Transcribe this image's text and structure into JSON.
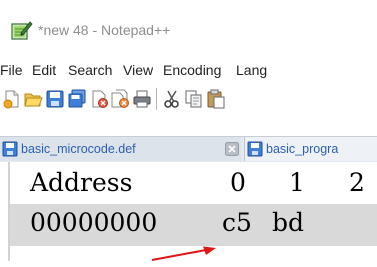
{
  "window": {
    "title": "*new 48 - Notepad++",
    "app_icon": "notepad-document-icon"
  },
  "menu": [
    "File",
    "Edit",
    "Search",
    "View",
    "Encoding",
    "Lang"
  ],
  "toolbar": {
    "icons": [
      "new-file-icon",
      "open-file-icon",
      "save-icon",
      "save-all-icon",
      "close-icon",
      "close-all-icon",
      "print-icon",
      "cut-icon",
      "copy-icon",
      "paste-icon"
    ]
  },
  "tabs": [
    {
      "label": "basic_microcode.def",
      "icon": "floppy-disk-icon",
      "active": true
    },
    {
      "label": "basic_progra",
      "icon": "floppy-disk-icon",
      "active": false
    }
  ],
  "table": {
    "header": [
      "Address",
      "0",
      "1",
      "2"
    ],
    "row": {
      "address": "00000000",
      "values": [
        "c5",
        "bd"
      ]
    }
  },
  "annotation": {
    "type": "arrow",
    "color": "#e01515"
  }
}
